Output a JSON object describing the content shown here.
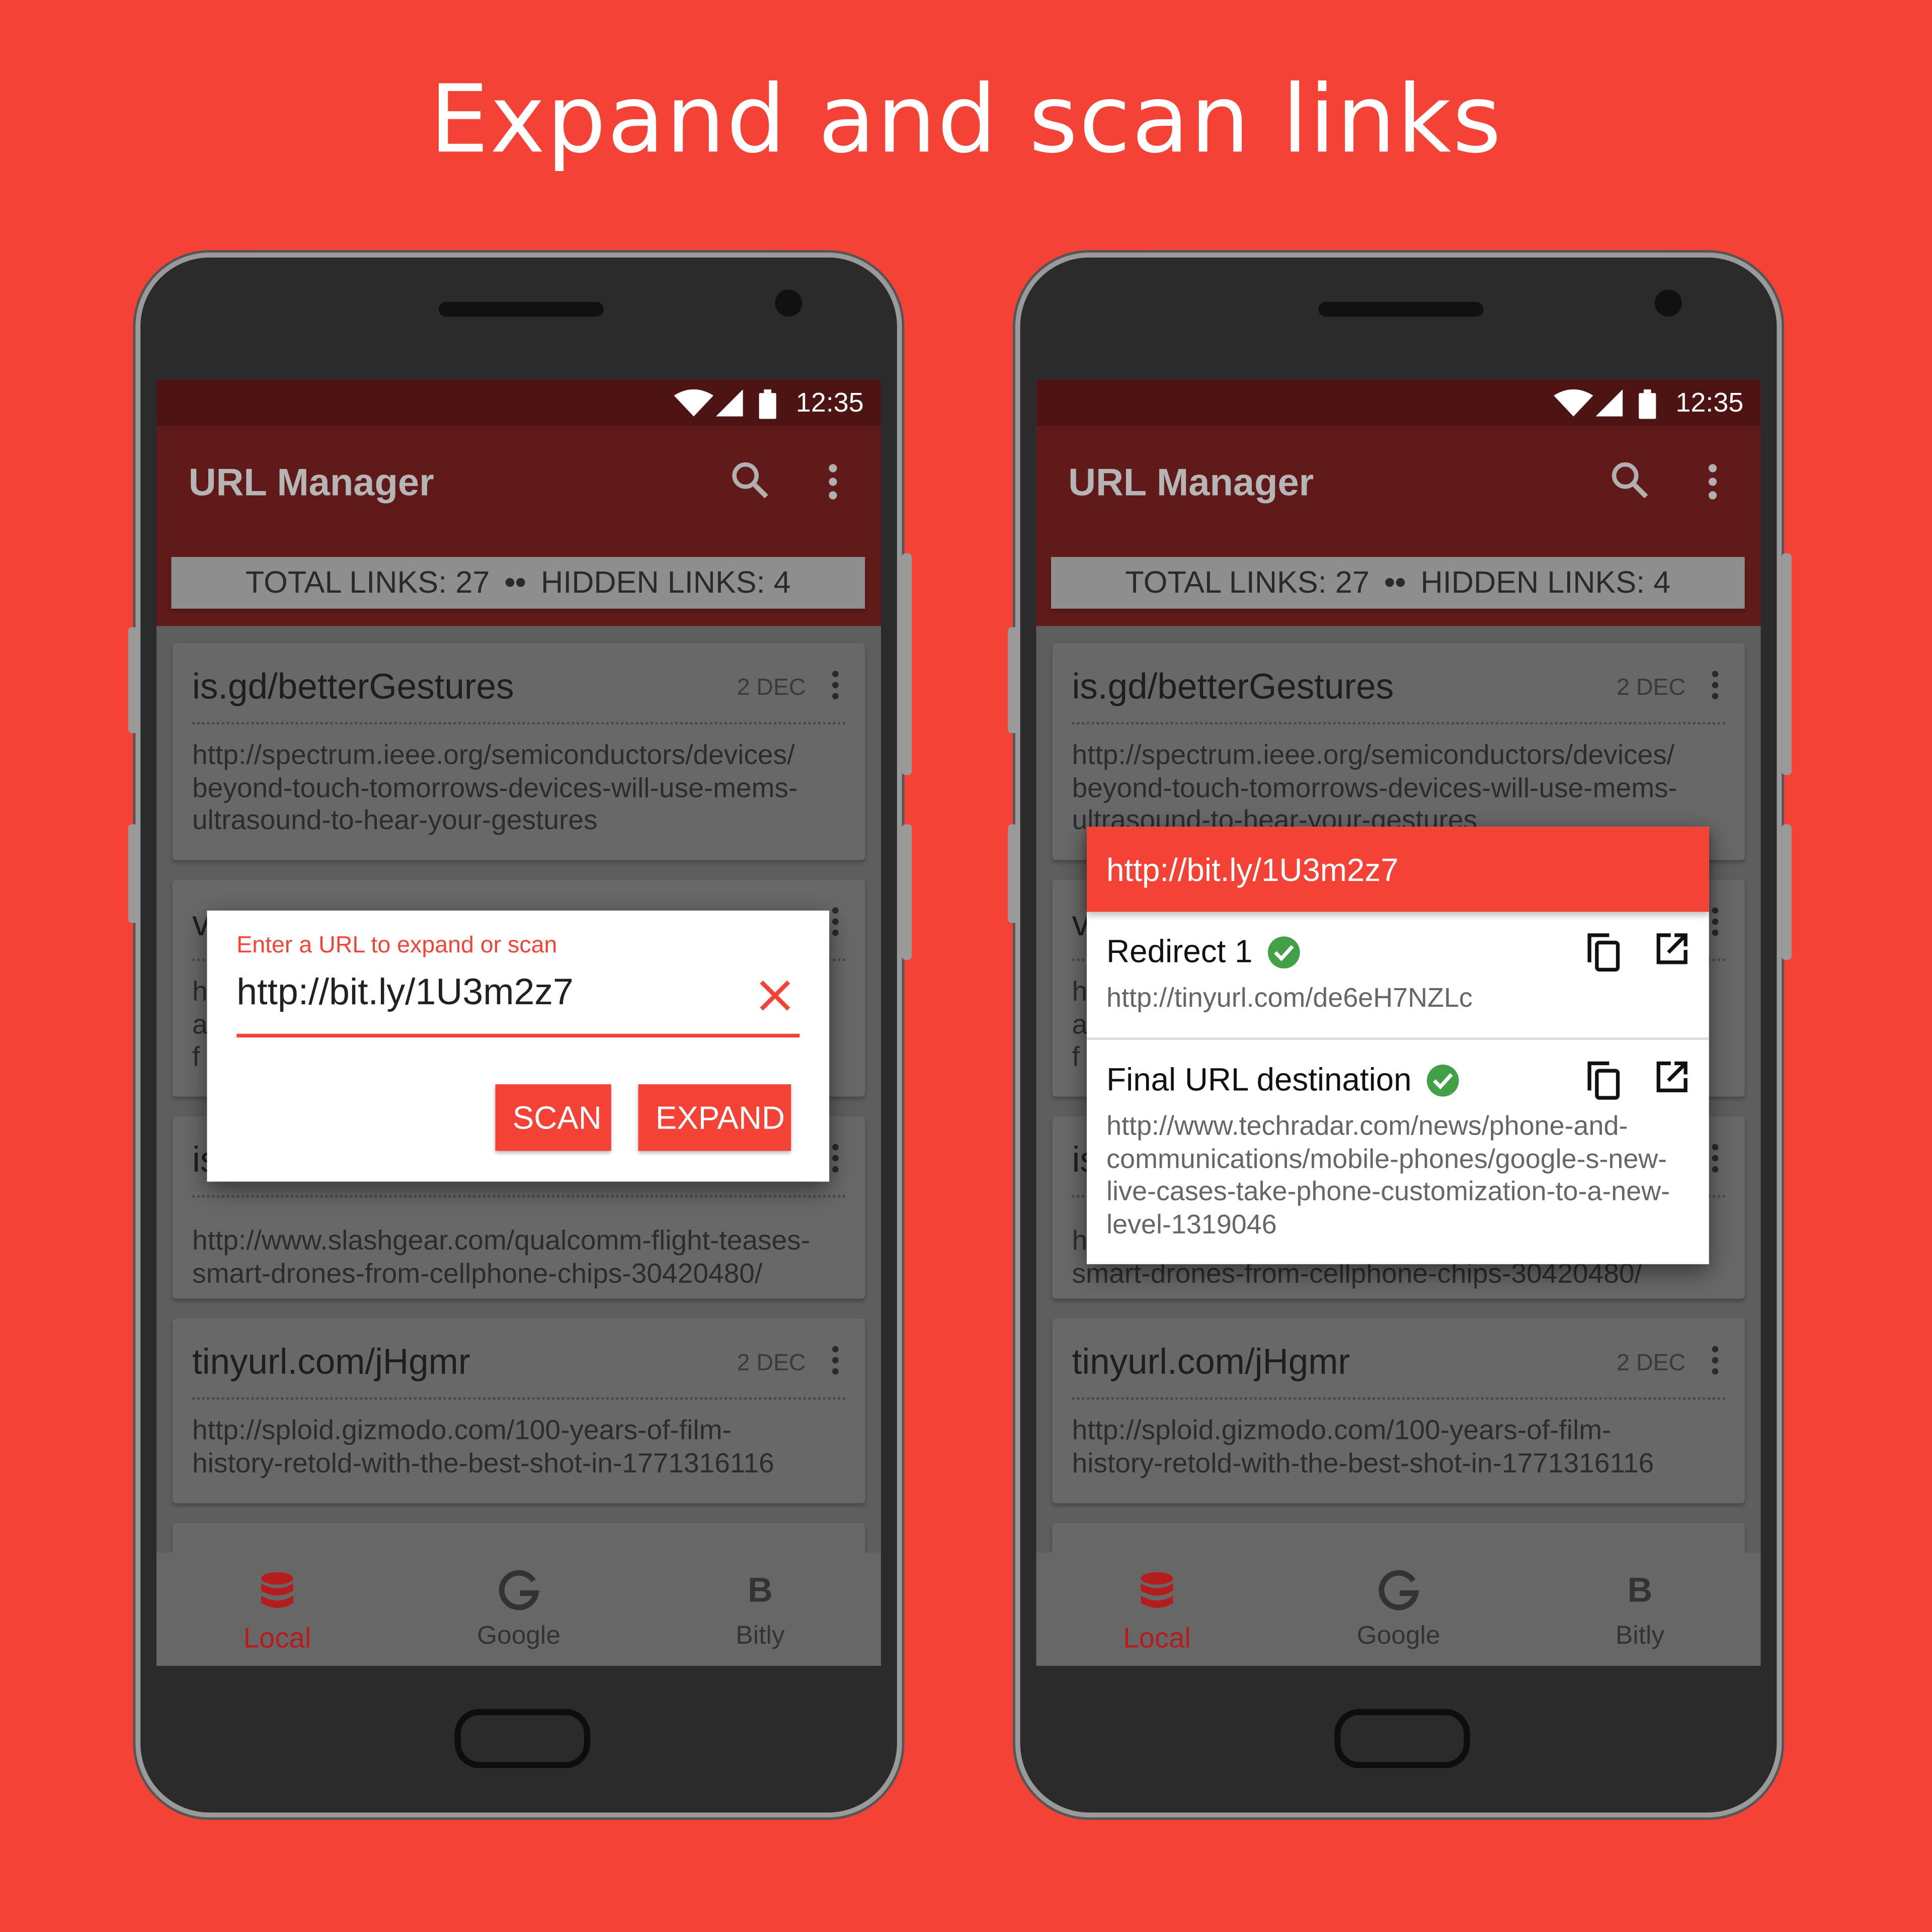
{
  "headline": "Expand and scan links",
  "colors": {
    "background": "#f44336",
    "accent": "#f44336",
    "check": "#43a047",
    "dim_appbar": "#611a1a"
  },
  "status": {
    "time": "12:35",
    "icons": [
      "wifi-icon",
      "signal-icon",
      "battery-icon"
    ]
  },
  "app": {
    "title": "URL Manager",
    "search_icon": "search-icon",
    "menu_icon": "more-vert-icon"
  },
  "stats": {
    "total": "TOTAL LINKS: 27",
    "separator": "••",
    "hidden": "HIDDEN LINKS: 4"
  },
  "cards": [
    {
      "title": "is.gd/betterGestures",
      "date": "2 DEC",
      "url_lines": [
        "http://spectrum.ieee.org/semiconductors/devices/",
        "beyond-touch-tomorrows-devices-will-use-mems-",
        "ultrasound-to-hear-your-gestures"
      ]
    },
    {
      "title": "v",
      "date": "",
      "url_lines": [
        "h",
        "a",
        "f"
      ]
    },
    {
      "title": "is",
      "date": "",
      "url_lines": [
        "http://www.slashgear.com/qualcomm-flight-teases-",
        "smart-drones-from-cellphone-chips-30420480/"
      ]
    },
    {
      "title": "tinyurl.com/jHgmr",
      "date": "2 DEC",
      "url_lines": [
        "http://sploid.gizmodo.com/100-years-of-film-",
        "history-retold-with-the-best-shot-in-1771316116"
      ]
    }
  ],
  "bottom_nav": [
    {
      "label": "Local",
      "icon": "database-icon",
      "active": true
    },
    {
      "label": "Google",
      "icon": "google-icon",
      "active": false
    },
    {
      "label": "Bitly",
      "icon": "bitly-icon",
      "active": false
    }
  ],
  "dialog": {
    "label": "Enter a URL to expand or scan",
    "value": "http://bit.ly/1U3m2z7",
    "scan": "SCAN",
    "expand": "EXPAND"
  },
  "result": {
    "header": "http://bit.ly/1U3m2z7",
    "redirect": {
      "title": "Redirect 1",
      "url": "http://tinyurl.com/de6eH7NZLc"
    },
    "final": {
      "title": "Final URL destination",
      "url": "http://www.techradar.com/news/phone-and-communications/mobile-phones/google-s-new-live-cases-take-phone-customization-to-a-new-level-1319046"
    }
  }
}
